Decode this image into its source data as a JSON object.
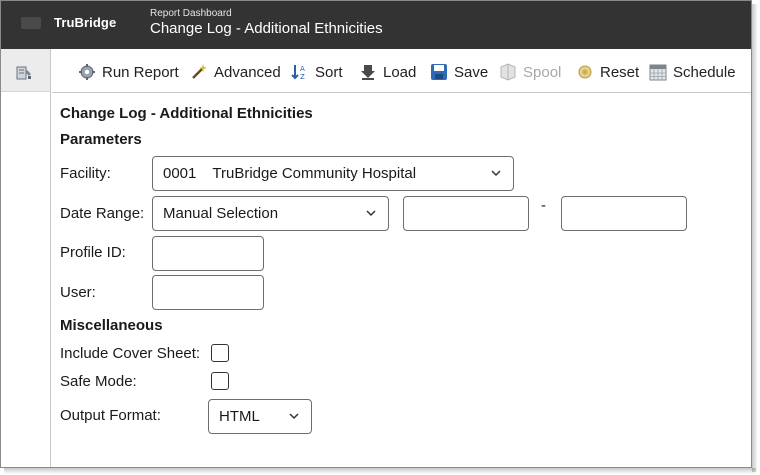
{
  "header": {
    "brand": "TruBridge",
    "breadcrumb": "Report Dashboard",
    "title": "Change Log - Additional Ethnicities"
  },
  "toolbar": {
    "run_report": "Run Report",
    "advanced": "Advanced",
    "sort": "Sort",
    "load": "Load",
    "save": "Save",
    "spool": "Spool",
    "reset": "Reset",
    "schedule": "Schedule"
  },
  "form": {
    "title": "Change Log - Additional Ethnicities",
    "parameters_heading": "Parameters",
    "facility_label": "Facility:",
    "facility_code": "0001",
    "facility_name": "TruBridge Community Hospital",
    "date_range_label": "Date Range:",
    "date_range_value": "Manual Selection",
    "date_start": "",
    "date_separator": "-",
    "date_end": "",
    "profile_id_label": "Profile ID:",
    "profile_id_value": "",
    "user_label": "User:",
    "user_value": "",
    "misc_heading": "Miscellaneous",
    "cover_sheet_label": "Include Cover Sheet:",
    "cover_sheet_checked": false,
    "safe_mode_label": "Safe Mode:",
    "safe_mode_checked": false,
    "output_format_label": "Output Format:",
    "output_format_value": "HTML"
  },
  "colors": {
    "header_bg": "#333333",
    "disabled_text": "#a8a8a8"
  }
}
